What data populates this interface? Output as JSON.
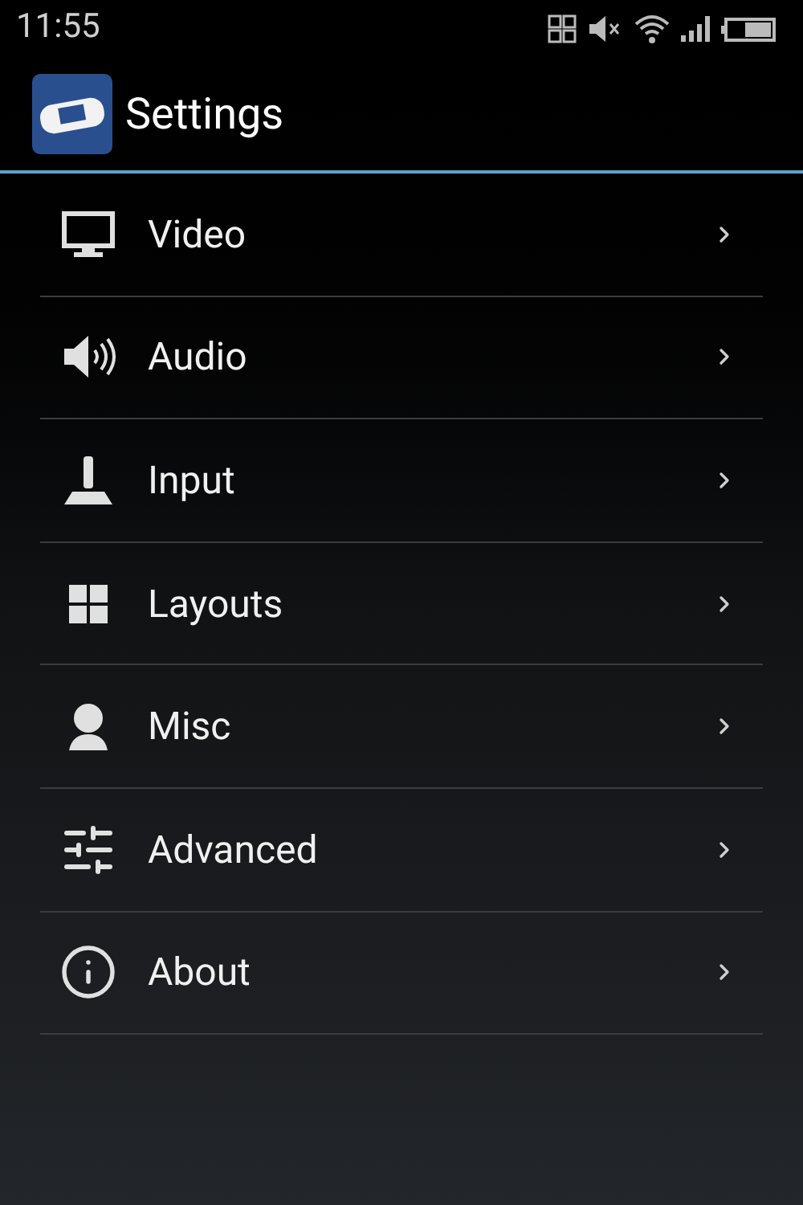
{
  "status_bar": {
    "time": "11:55"
  },
  "app_bar": {
    "title": "Settings"
  },
  "items": [
    {
      "label": "Video"
    },
    {
      "label": "Audio"
    },
    {
      "label": "Input"
    },
    {
      "label": "Layouts"
    },
    {
      "label": "Misc"
    },
    {
      "label": "Advanced"
    },
    {
      "label": "About"
    }
  ]
}
